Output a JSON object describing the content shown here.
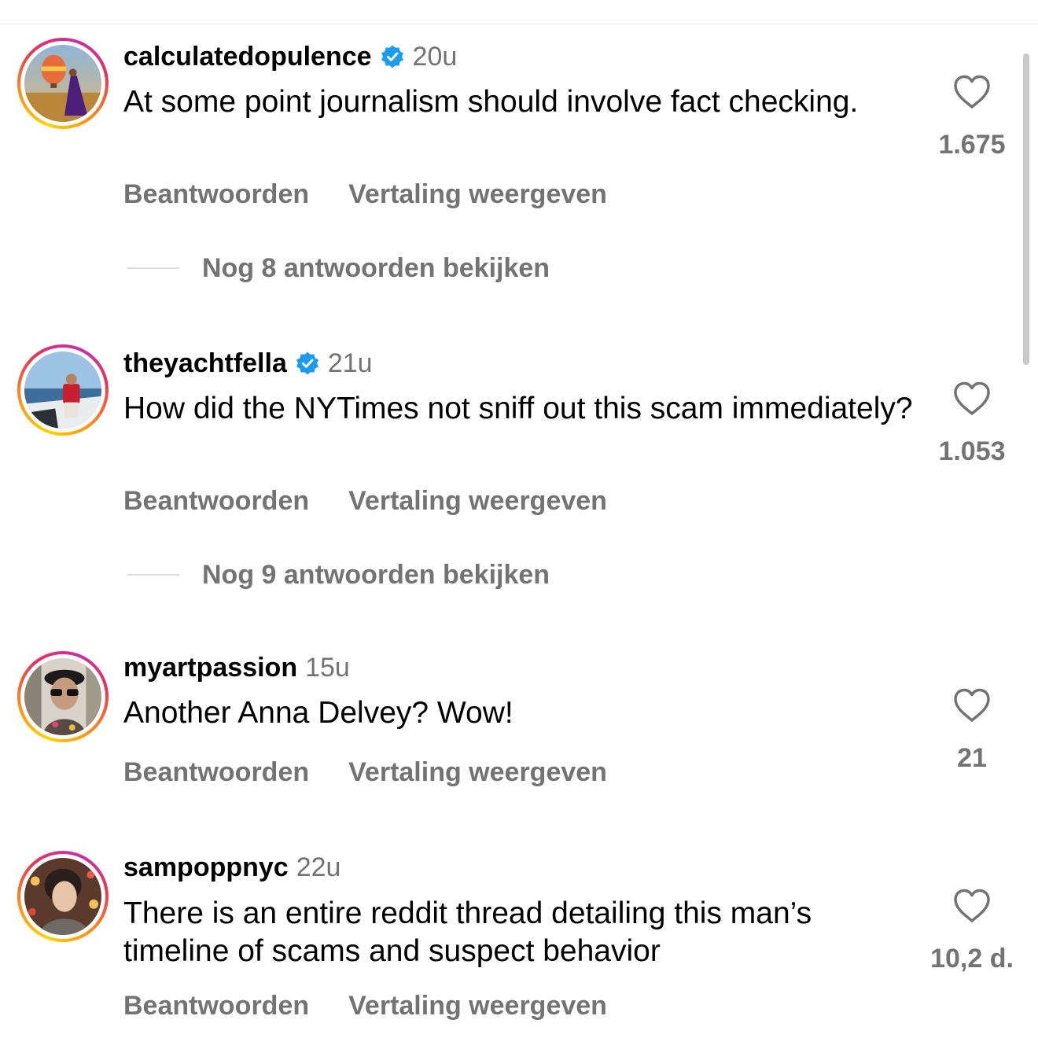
{
  "ui": {
    "ring_colors": [
      "#fdd400",
      "#fc8d1a",
      "#e7325a",
      "#c72fa9"
    ],
    "verified_color": "#1d9bf0",
    "muted_color": "#737373",
    "icons": {
      "like": "heart-outline-icon",
      "verified": "verified-badge-icon"
    }
  },
  "comments": [
    {
      "username": "calculatedopulence",
      "verified": true,
      "time": "20u",
      "text": "At some point journalism should involve fact checking.",
      "reply_label": "Beantwoorden",
      "translate_label": "Vertaling weergeven",
      "likes": "1.675",
      "more_replies": "Nog 8 antwoorden bekijken"
    },
    {
      "username": "theyachtfella",
      "verified": true,
      "time": "21u",
      "text": "How did the NYTimes not sniff out this scam immediately?",
      "reply_label": "Beantwoorden",
      "translate_label": "Vertaling weergeven",
      "likes": "1.053",
      "more_replies": "Nog 9 antwoorden bekijken"
    },
    {
      "username": "myartpassion",
      "verified": false,
      "time": "15u",
      "text": "Another Anna Delvey? Wow!",
      "reply_label": "Beantwoorden",
      "translate_label": "Vertaling weergeven",
      "likes": "21"
    },
    {
      "username": "sampoppnyc",
      "verified": false,
      "time": "22u",
      "text": "There is an entire reddit thread detailing this man’s timeline of scams and suspect behavior",
      "reply_label": "Beantwoorden",
      "translate_label": "Vertaling weergeven",
      "likes": "10,2 d."
    }
  ]
}
